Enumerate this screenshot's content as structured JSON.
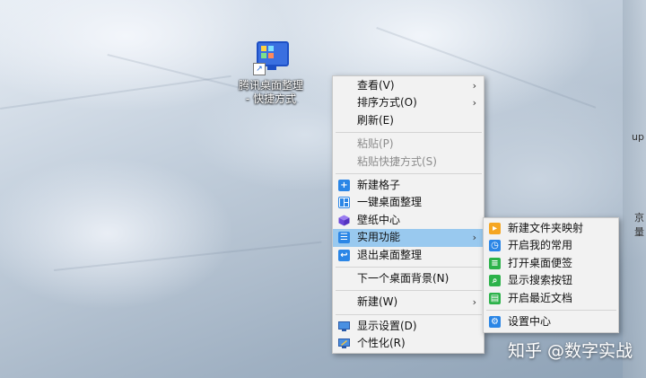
{
  "desktop": {
    "edge_texts": [
      "up",
      "京",
      "量"
    ],
    "watermark": "知乎 @数字实战"
  },
  "shortcut": {
    "label_line1": "腾讯桌面整理",
    "label_line2": "- 快捷方式"
  },
  "context_menu": {
    "items": [
      {
        "label": "查看(V)",
        "submenu": true
      },
      {
        "label": "排序方式(O)",
        "submenu": true
      },
      {
        "label": "刷新(E)"
      },
      {
        "label": "粘贴(P)",
        "disabled": true
      },
      {
        "label": "粘贴快捷方式(S)",
        "disabled": true
      },
      {
        "label": "新建格子",
        "icon": "plus-icon"
      },
      {
        "label": "一键桌面整理",
        "icon": "layout-icon"
      },
      {
        "label": "壁纸中心",
        "icon": "cube-icon"
      },
      {
        "label": "实用功能",
        "icon": "list-icon",
        "submenu": true,
        "highlighted": true
      },
      {
        "label": "退出桌面整理",
        "icon": "exit-icon"
      },
      {
        "label": "下一个桌面背景(N)"
      },
      {
        "label": "新建(W)",
        "submenu": true
      },
      {
        "label": "显示设置(D)",
        "icon": "display-icon"
      },
      {
        "label": "个性化(R)",
        "icon": "personalize-icon"
      }
    ]
  },
  "submenu": {
    "items": [
      {
        "label": "新建文件夹映射",
        "icon": "folder-map-icon",
        "color": "#f5a623"
      },
      {
        "label": "开启我的常用",
        "icon": "clock-icon",
        "color": "#2b86e6"
      },
      {
        "label": "打开桌面便签",
        "icon": "note-icon",
        "color": "#2cb24a"
      },
      {
        "label": "显示搜索按钮",
        "icon": "search-icon",
        "color": "#2cb24a"
      },
      {
        "label": "开启最近文档",
        "icon": "document-icon",
        "color": "#2cb24a"
      },
      {
        "label": "设置中心",
        "icon": "gear-icon",
        "color": "#2b86e6"
      }
    ]
  },
  "colors": {
    "highlight": "#99c9ef",
    "menu_bg": "#f2f2f2",
    "accent_blue": "#2b86e6"
  }
}
